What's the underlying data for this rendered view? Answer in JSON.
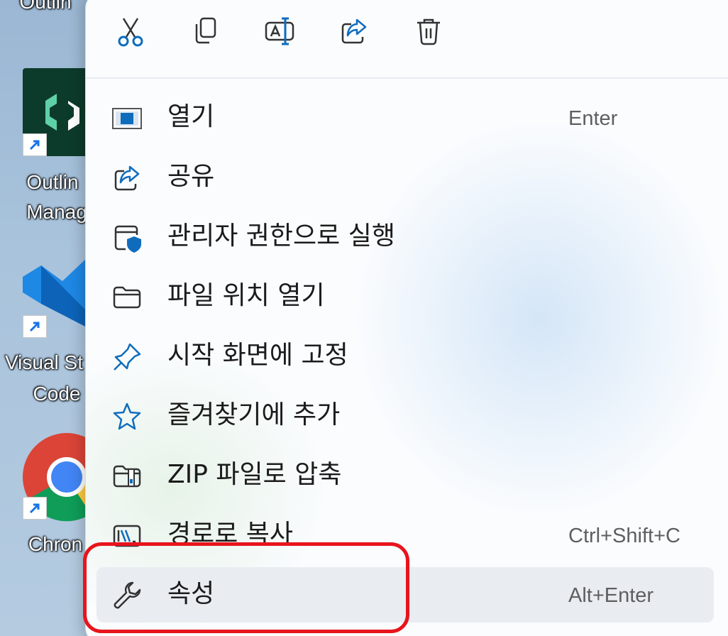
{
  "desktop": {
    "items": [
      {
        "label_line1": "Outlin",
        "label_line2": ""
      },
      {
        "label_line1": "Outlin",
        "label_line2": "Manag"
      },
      {
        "label_line1": "Visual St",
        "label_line2": "Code"
      },
      {
        "label_line1": "Chron",
        "label_line2": ""
      }
    ]
  },
  "toolbar": {
    "icons": [
      "cut-icon",
      "copy-icon",
      "rename-icon",
      "share-icon",
      "delete-icon"
    ]
  },
  "menu": {
    "items": [
      {
        "label": "열기",
        "shortcut": "Enter",
        "icon": "open-window-icon"
      },
      {
        "label": "공유",
        "shortcut": "",
        "icon": "share-icon"
      },
      {
        "label": "관리자 권한으로 실행",
        "shortcut": "",
        "icon": "shield-window-icon"
      },
      {
        "label": "파일 위치 열기",
        "shortcut": "",
        "icon": "folder-icon"
      },
      {
        "label": "시작 화면에 고정",
        "shortcut": "",
        "icon": "pin-icon"
      },
      {
        "label": "즐겨찾기에 추가",
        "shortcut": "",
        "icon": "star-icon"
      },
      {
        "label": "ZIP 파일로 압축",
        "shortcut": "",
        "icon": "zip-folder-icon"
      },
      {
        "label": "경로로 복사",
        "shortcut": "Ctrl+Shift+C",
        "icon": "copy-path-icon"
      },
      {
        "label": "속성",
        "shortcut": "Alt+Enter",
        "icon": "wrench-icon"
      }
    ]
  },
  "colors": {
    "accent_blue": "#0f6cbd",
    "highlight_red": "#e8141c",
    "text": "#1b1b1b",
    "shortcut_text": "#5f5f5f"
  }
}
